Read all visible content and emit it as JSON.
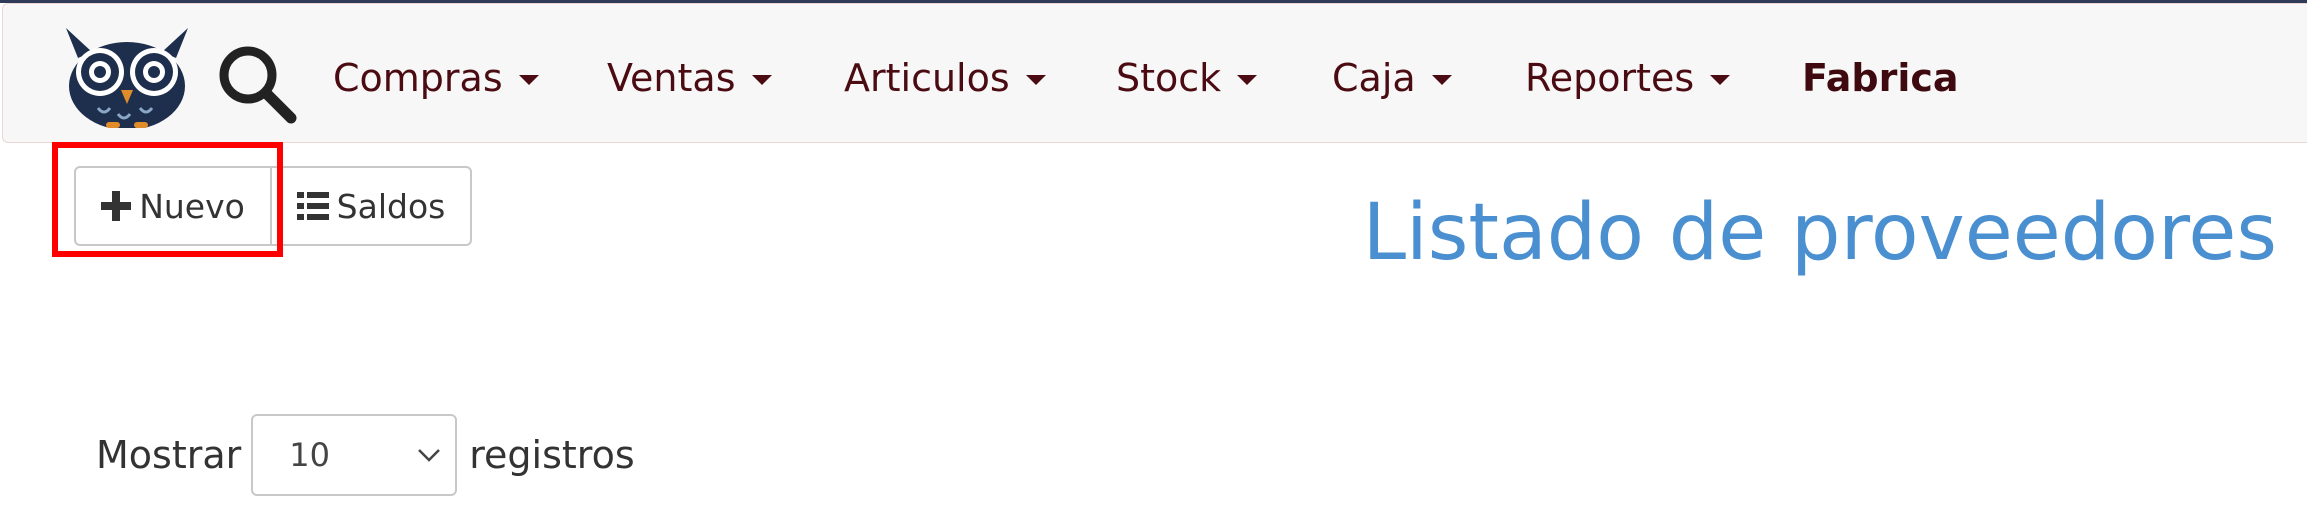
{
  "nav": {
    "items": [
      {
        "label": "Compras",
        "dropdown": true
      },
      {
        "label": "Ventas",
        "dropdown": true
      },
      {
        "label": "Articulos",
        "dropdown": true
      },
      {
        "label": "Stock",
        "dropdown": true
      },
      {
        "label": "Caja",
        "dropdown": true
      },
      {
        "label": "Reportes",
        "dropdown": true
      },
      {
        "label": "Fabrica",
        "dropdown": false
      }
    ]
  },
  "toolbar": {
    "new_label": "Nuevo",
    "balances_label": "Saldos"
  },
  "page": {
    "title": "Listado de proveedores"
  },
  "table_length": {
    "prefix": "Mostrar",
    "selected": "10",
    "suffix": "registros"
  },
  "colors": {
    "nav_text": "#4a0c12",
    "title": "#4a8fd0",
    "highlight": "#ff0000"
  },
  "icons": {
    "logo": "owl-logo",
    "search": "search-icon",
    "new": "plus-icon",
    "balances": "list-icon",
    "select": "chevron-down-icon"
  }
}
